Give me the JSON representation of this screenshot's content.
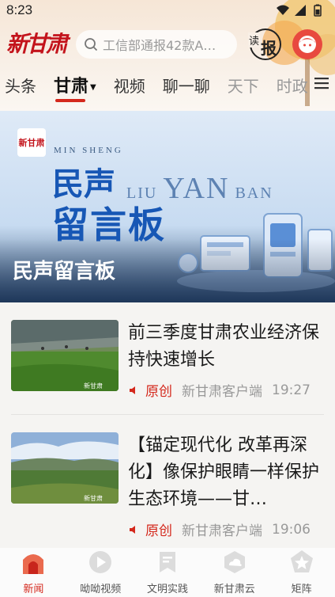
{
  "status_bar": {
    "time": "8:23"
  },
  "header": {
    "logo_text": "新甘肃",
    "search_placeholder": "工信部通报42款A…",
    "read_paper_top": "读",
    "read_paper_main": "报"
  },
  "tabs": [
    {
      "label": "头条"
    },
    {
      "label": "甘肃",
      "active": true
    },
    {
      "label": "视频"
    },
    {
      "label": "聊一聊"
    },
    {
      "label": "天下"
    },
    {
      "label": "时政"
    }
  ],
  "banner": {
    "logo_text": "新甘肃",
    "subtitle_en": "MIN SHENG",
    "title_line1": "民声",
    "title_line2": "留言板",
    "english_a": "LIU",
    "english_b": "YAN",
    "english_c": "BAN",
    "caption": "民声留言板"
  },
  "news": [
    {
      "title": "前三季度甘肃农业经济保持快速增长",
      "tag": "原创",
      "source": "新甘肃客户端",
      "time": "19:27",
      "watermark": "新甘肃"
    },
    {
      "title": "【锚定现代化  改革再深化】像保护眼睛一样保护生态环境——甘…",
      "tag": "原创",
      "source": "新甘肃客户端",
      "time": "19:06",
      "watermark": "新甘肃"
    }
  ],
  "bottom_nav": [
    {
      "label": "新闻",
      "icon": "news-home-icon",
      "active": true
    },
    {
      "label": "呦呦视频",
      "icon": "video-play-icon"
    },
    {
      "label": "文明实践",
      "icon": "bookmark-icon"
    },
    {
      "label": "新甘肃云",
      "icon": "cloud-icon"
    },
    {
      "label": "矩阵",
      "icon": "star-badge-icon"
    }
  ],
  "colors": {
    "brand_red": "#d4281c",
    "banner_blue": "#1757b5"
  }
}
